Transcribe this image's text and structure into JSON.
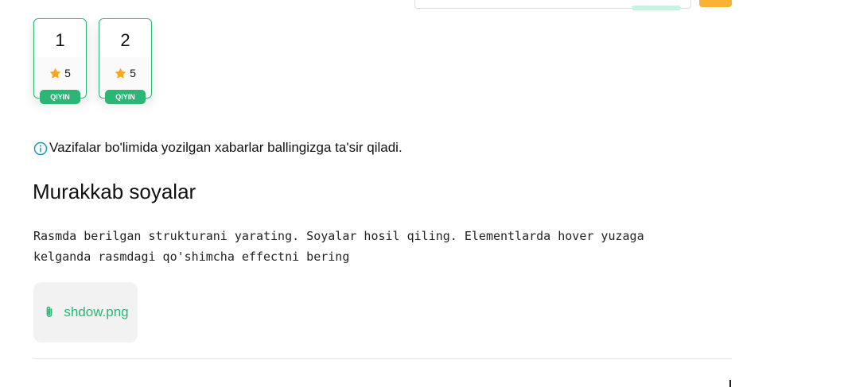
{
  "header": {
    "accent_orange": "#f9b233"
  },
  "tasks": [
    {
      "number": "1",
      "score": "5",
      "difficulty": "QIYIN"
    },
    {
      "number": "2",
      "score": "5",
      "difficulty": "QIYIN"
    }
  ],
  "info": {
    "text": "Vazifalar bo'limida yozilgan xabarlar ballingizga ta'sir qiladi.",
    "icon": "info-icon"
  },
  "exercise": {
    "title": "Murakkab soyalar",
    "description": "Rasmda berilgan strukturani yarating. Soyalar hosil qiling. Elementlarda hover yuzaga\nkelganda rasmdagi qo'shimcha effectni bering"
  },
  "attachment": {
    "filename": "shdow.png",
    "icon": "paperclip-icon"
  },
  "colors": {
    "accent_green": "#2bb673",
    "star": "#f5a623"
  }
}
